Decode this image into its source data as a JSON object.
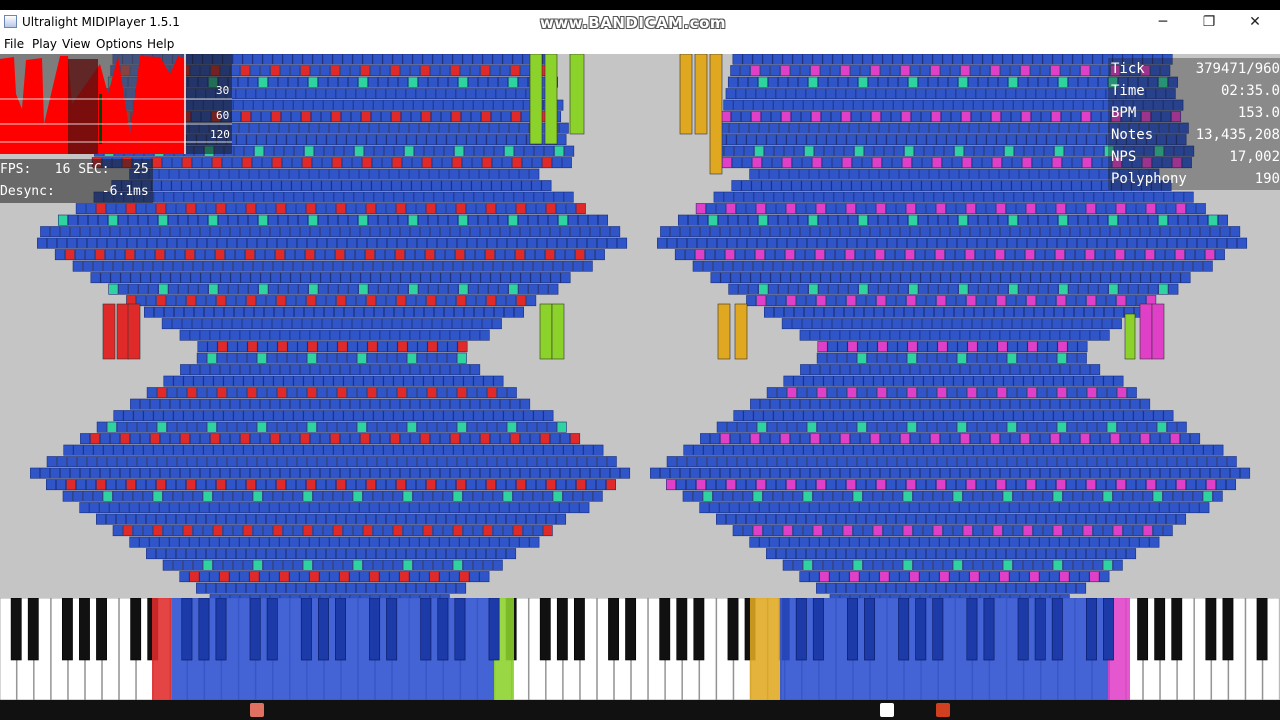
{
  "window": {
    "title": "Ultralight MIDIPlayer 1.5.1"
  },
  "watermark": "www.BANDICAM.com",
  "window_controls": {
    "minimize": "─",
    "maximize": "❐",
    "close": "✕"
  },
  "menu": [
    "File",
    "Play",
    "View",
    "Options",
    "Help"
  ],
  "graph": {
    "ticks": [
      "30",
      "60",
      "120"
    ]
  },
  "stats_left": {
    "fps_line": "FPS:   16 SEC:   25",
    "desync_line": "Desync:      -6.1ms"
  },
  "stats_right": [
    {
      "label": "Tick",
      "value": "379471/960"
    },
    {
      "label": "Time",
      "value": "02:35.0"
    },
    {
      "label": "BPM",
      "value": "153.0"
    },
    {
      "label": "Notes",
      "value": "13,435,208"
    },
    {
      "label": "NPS",
      "value": "17,002"
    },
    {
      "label": "Polyphony",
      "value": "190"
    }
  ],
  "colors": {
    "note_blue": "#2f55c8",
    "note_red": "#e02a2a",
    "note_green": "#8bd32a",
    "note_teal": "#2ed3a0",
    "note_orange": "#e0a820",
    "note_magenta": "#e040c8",
    "background": "#c5c5c5"
  },
  "icons": {
    "app": "midi-player-icon",
    "min": "minimize-icon",
    "max": "maximize-icon",
    "close": "close-icon"
  }
}
